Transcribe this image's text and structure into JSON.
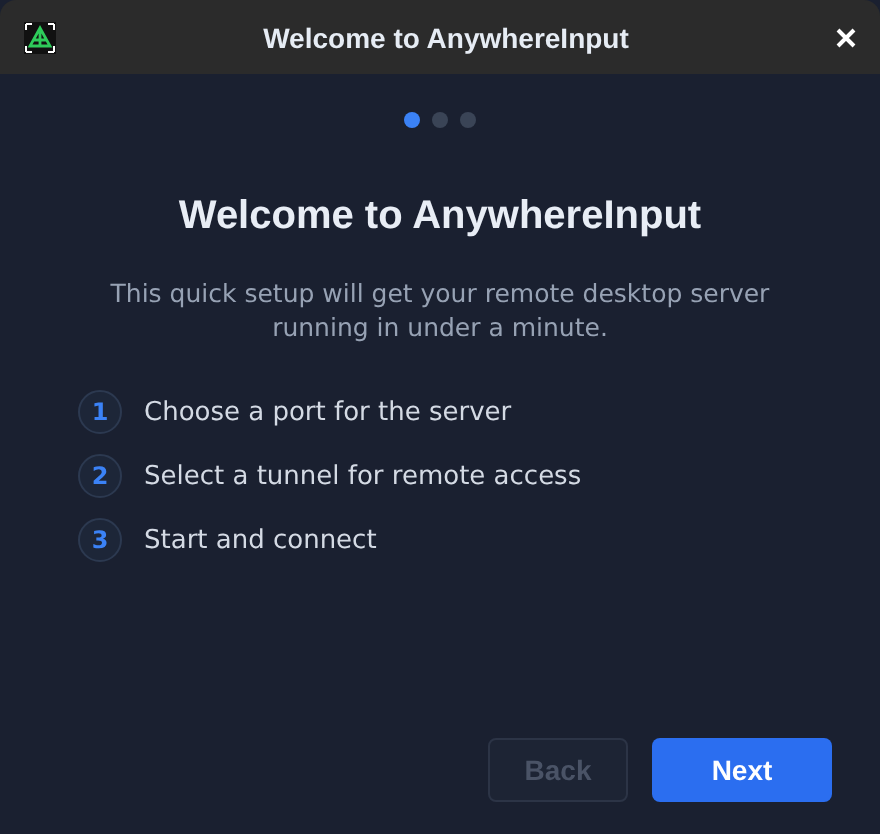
{
  "window": {
    "title": "Welcome to AnywhereInput"
  },
  "pager": [
    {
      "selected": true
    },
    {
      "selected": false
    },
    {
      "selected": false
    }
  ],
  "heading": "Welcome to AnywhereInput",
  "description": "This quick setup will get your remote desktop server running in under a minute.",
  "steps": [
    {
      "number": "1",
      "label": "Choose a port for the server"
    },
    {
      "number": "2",
      "label": "Select a tunnel for remote access"
    },
    {
      "number": "3",
      "label": "Start and connect"
    }
  ],
  "buttons": [
    {
      "label": "Back",
      "kind": "secondary",
      "disabled": true
    },
    {
      "label": "Next",
      "kind": "primary",
      "disabled": false
    }
  ]
}
